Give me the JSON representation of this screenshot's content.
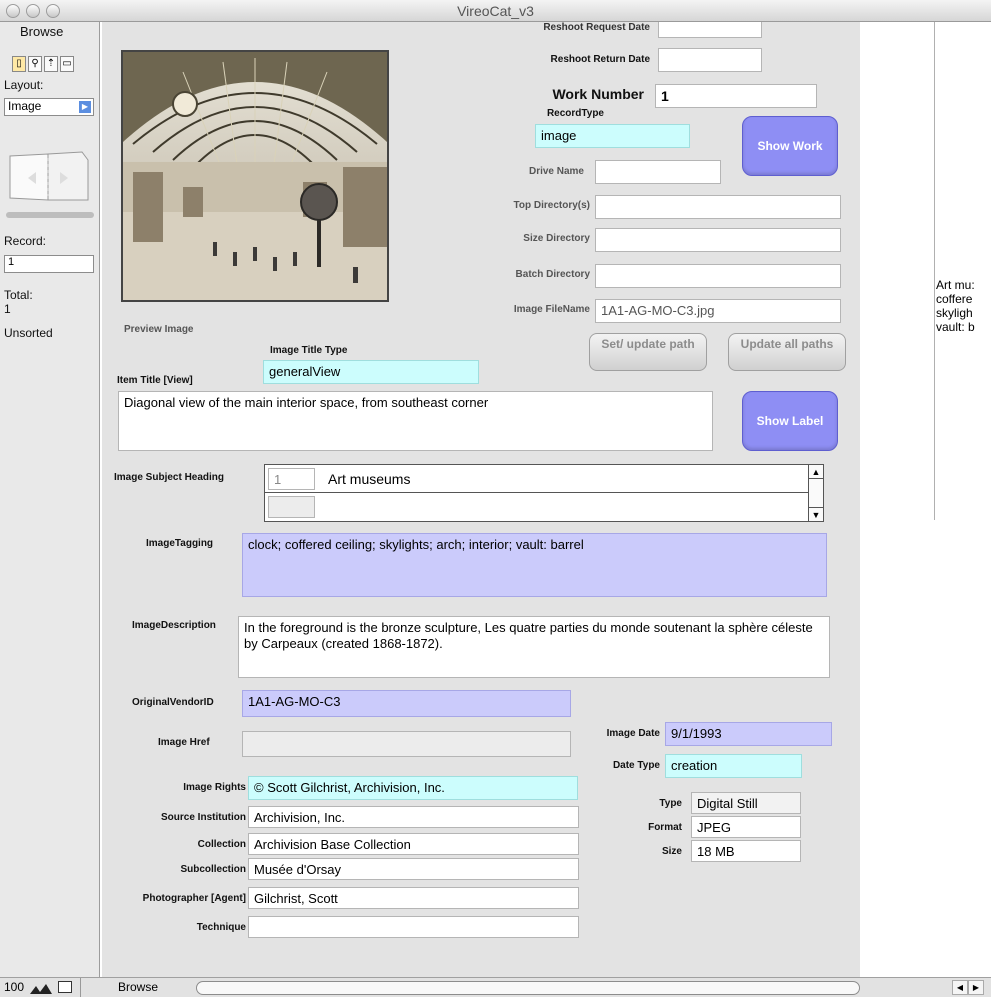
{
  "window": {
    "title": "VireoCat_v3"
  },
  "sidebar": {
    "mode": "Browse",
    "layout_label": "Layout:",
    "layout_value": "Image",
    "record_label": "Record:",
    "record_value": "1",
    "total_label": "Total:",
    "total_value": "1",
    "sort_status": "Unsorted"
  },
  "fields": {
    "reshoot_request_label": "Reshoot Request Date",
    "reshoot_return_label": "Reshoot Return Date",
    "work_number_label": "Work Number",
    "work_number_value": "1",
    "record_type_label": "RecordType",
    "record_type_value": "image",
    "drive_name_label": "Drive Name",
    "top_directory_label": "Top Directory(s)",
    "size_directory_label": "Size Directory",
    "batch_directory_label": "Batch Directory",
    "image_filename_label": "Image FileName",
    "image_filename_value": "1A1-AG-MO-C3.jpg",
    "preview_label": "Preview Image",
    "image_title_type_label": "Image Title Type",
    "image_title_type_value": "generalView",
    "item_title_label": "Item Title [View]",
    "item_title_value": "Diagonal view of the main interior space, from southeast corner",
    "subject_heading_label": "Image Subject Heading",
    "subject_heading_index": "1",
    "subject_heading_value": "Art museums",
    "tagging_label": "ImageTagging",
    "tagging_value": "clock; coffered ceiling; skylights; arch; interior; vault: barrel",
    "description_label": "ImageDescription",
    "description_value": "In the foreground is the bronze sculpture, Les quatre parties du monde soutenant la sphère céleste by Carpeaux (created 1868-1872).",
    "vendor_id_label": "OriginalVendorID",
    "vendor_id_value": "1A1-AG-MO-C3",
    "image_href_label": "Image Href",
    "image_date_label": "Image Date",
    "image_date_value": "9/1/1993",
    "date_type_label": "Date Type",
    "date_type_value": "creation",
    "rights_label": "Image Rights",
    "rights_value": "© Scott Gilchrist, Archivision, Inc.",
    "source_label": "Source Institution",
    "source_value": "Archivision, Inc.",
    "collection_label": "Collection",
    "collection_value": "Archivision Base Collection",
    "subcollection_label": "Subcollection",
    "subcollection_value": "Musée d'Orsay",
    "photographer_label": "Photographer [Agent]",
    "photographer_value": "Gilchrist, Scott",
    "technique_label": "Technique",
    "type_label": "Type",
    "type_value": "Digital Still",
    "format_label": "Format",
    "format_value": "JPEG",
    "size_label": "Size",
    "size_value": "18 MB"
  },
  "buttons": {
    "show_work": "Show Work",
    "set_update_path": "Set/ update path",
    "update_all_paths": "Update all paths",
    "show_label": "Show Label"
  },
  "right_panel": {
    "lines": [
      "Art mu:",
      "coffere",
      "skyligh",
      "vault: b"
    ]
  },
  "bottom_bar": {
    "zoom": "100",
    "mode": "Browse"
  }
}
